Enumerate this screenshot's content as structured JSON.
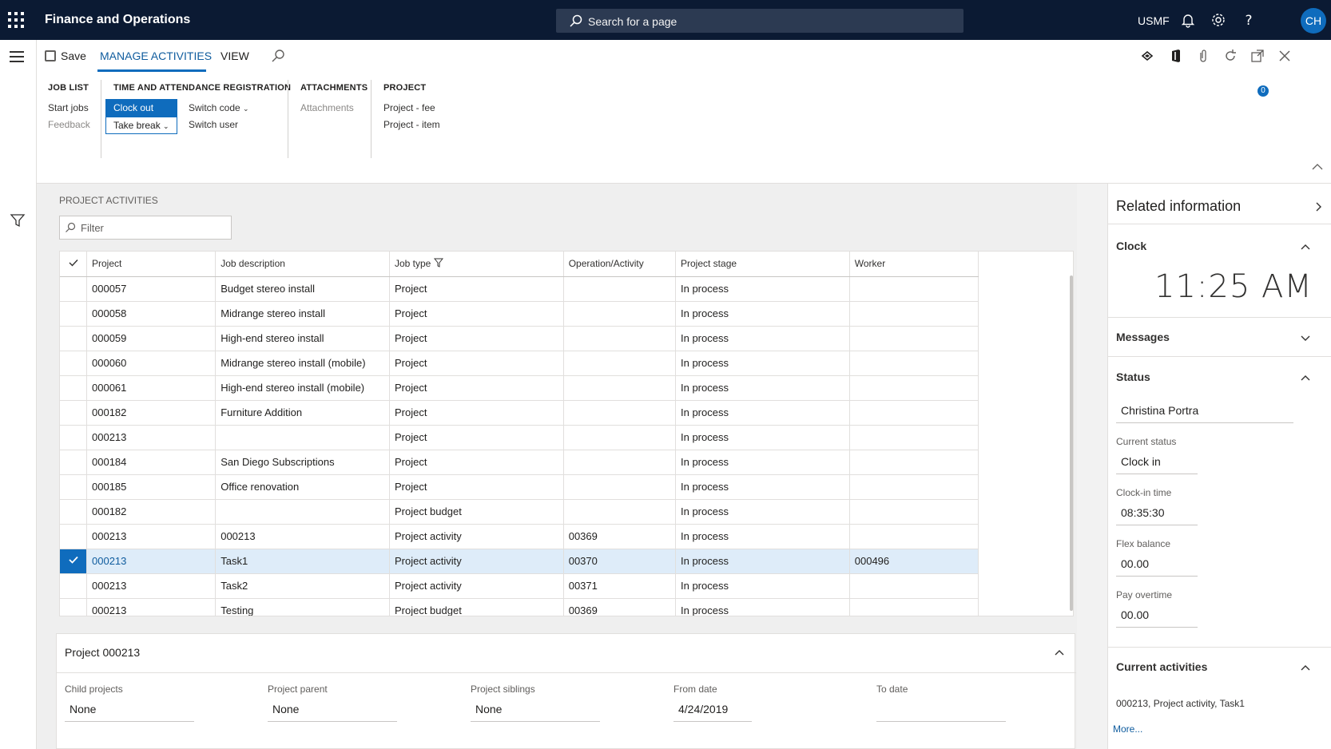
{
  "app": {
    "title": "Finance and Operations",
    "search_placeholder": "Search for a page",
    "company": "USMF",
    "user_initials": "CH"
  },
  "action_pane": {
    "save_label": "Save",
    "tabs": [
      "MANAGE ACTIVITIES",
      "VIEW"
    ],
    "notification_count": "0",
    "groups": {
      "job_list": {
        "title": "JOB LIST",
        "start_jobs": "Start jobs",
        "feedback": "Feedback"
      },
      "time": {
        "title": "TIME AND ATTENDANCE REGISTRATION",
        "clock_out": "Clock out",
        "take_break": "Take break",
        "switch_code": "Switch code",
        "switch_user": "Switch user"
      },
      "attachments": {
        "title": "ATTACHMENTS",
        "attachments": "Attachments"
      },
      "project": {
        "title": "PROJECT",
        "project_fee": "Project - fee",
        "project_item": "Project - item"
      }
    }
  },
  "main": {
    "section_label": "PROJECT ACTIVITIES",
    "filter_placeholder": "Filter",
    "columns": [
      "Project",
      "Job description",
      "Job type",
      "Operation/Activity",
      "Project stage",
      "Worker"
    ],
    "rows": [
      {
        "project": "000057",
        "desc": "Budget stereo install",
        "type": "Project",
        "op": "",
        "stage": "In process",
        "worker": ""
      },
      {
        "project": "000058",
        "desc": "Midrange stereo install",
        "type": "Project",
        "op": "",
        "stage": "In process",
        "worker": ""
      },
      {
        "project": "000059",
        "desc": "High-end stereo install",
        "type": "Project",
        "op": "",
        "stage": "In process",
        "worker": ""
      },
      {
        "project": "000060",
        "desc": "Midrange stereo install (mobile)",
        "type": "Project",
        "op": "",
        "stage": "In process",
        "worker": ""
      },
      {
        "project": "000061",
        "desc": "High-end stereo install (mobile)",
        "type": "Project",
        "op": "",
        "stage": "In process",
        "worker": ""
      },
      {
        "project": "000182",
        "desc": "Furniture Addition",
        "type": "Project",
        "op": "",
        "stage": "In process",
        "worker": ""
      },
      {
        "project": "000213",
        "desc": "",
        "type": "Project",
        "op": "",
        "stage": "In process",
        "worker": ""
      },
      {
        "project": "000184",
        "desc": "San Diego Subscriptions",
        "type": "Project",
        "op": "",
        "stage": "In process",
        "worker": ""
      },
      {
        "project": "000185",
        "desc": "Office renovation",
        "type": "Project",
        "op": "",
        "stage": "In process",
        "worker": ""
      },
      {
        "project": "000182",
        "desc": "",
        "type": "Project budget",
        "op": "",
        "stage": "In process",
        "worker": ""
      },
      {
        "project": "000213",
        "desc": "000213",
        "type": "Project activity",
        "op": "00369",
        "stage": "In process",
        "worker": ""
      },
      {
        "project": "000213",
        "desc": "Task1",
        "type": "Project activity",
        "op": "00370",
        "stage": "In process",
        "worker": "000496",
        "selected": true
      },
      {
        "project": "000213",
        "desc": "Task2",
        "type": "Project activity",
        "op": "00371",
        "stage": "In process",
        "worker": ""
      },
      {
        "project": "000213",
        "desc": "Testing",
        "type": "Project budget",
        "op": "00369",
        "stage": "In process",
        "worker": ""
      }
    ],
    "detail": {
      "title": "Project 000213",
      "fields": [
        {
          "label": "Child projects",
          "value": "None"
        },
        {
          "label": "Project parent",
          "value": "None"
        },
        {
          "label": "Project siblings",
          "value": "None"
        },
        {
          "label": "From date",
          "value": "4/24/2019"
        },
        {
          "label": "To date",
          "value": ""
        }
      ]
    }
  },
  "right_pane": {
    "title": "Related information",
    "clock": {
      "heading": "Clock",
      "time": "11:25 AM"
    },
    "messages": {
      "heading": "Messages"
    },
    "status": {
      "heading": "Status",
      "worker_name": "Christina Portra",
      "current_status_label": "Current status",
      "current_status": "Clock in",
      "clock_in_label": "Clock-in time",
      "clock_in": "08:35:30",
      "flex_label": "Flex balance",
      "flex": "00.00",
      "overtime_label": "Pay overtime",
      "overtime": "00.00"
    },
    "current_activities": {
      "heading": "Current activities",
      "text": "000213, Project activity, Task1",
      "more": "More..."
    }
  },
  "colors": {
    "nav_bg": "#0b1a33",
    "accent": "#0f6cbd",
    "selected_row": "#deecf9"
  }
}
